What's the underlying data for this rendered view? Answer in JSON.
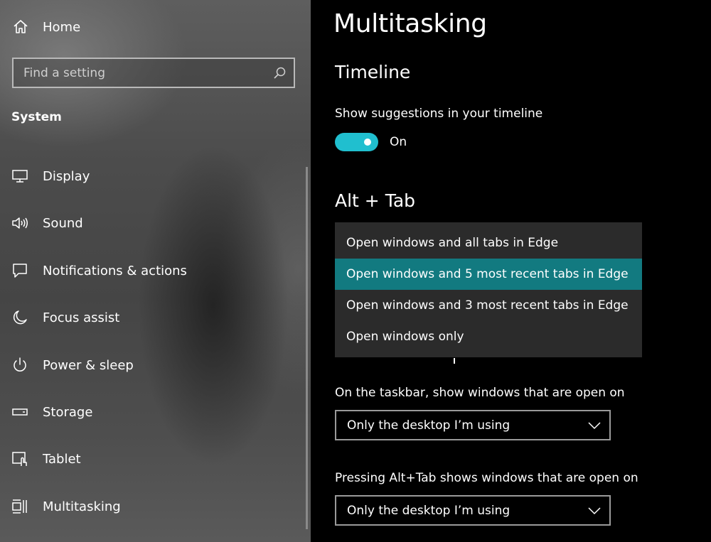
{
  "sidebar": {
    "home_label": "Home",
    "search_placeholder": "Find a setting",
    "section_title": "System",
    "items": [
      {
        "label": "Display",
        "icon": "monitor-icon"
      },
      {
        "label": "Sound",
        "icon": "speaker-icon"
      },
      {
        "label": "Notifications & actions",
        "icon": "notification-icon"
      },
      {
        "label": "Focus assist",
        "icon": "moon-icon"
      },
      {
        "label": "Power & sleep",
        "icon": "power-icon"
      },
      {
        "label": "Storage",
        "icon": "storage-icon"
      },
      {
        "label": "Tablet",
        "icon": "tablet-icon"
      },
      {
        "label": "Multitasking",
        "icon": "multitasking-icon"
      }
    ]
  },
  "main": {
    "title": "Multitasking",
    "timeline": {
      "heading": "Timeline",
      "suggestions_label": "Show suggestions in your timeline",
      "toggle_state": "On",
      "toggle_on": true
    },
    "alt_tab": {
      "heading": "Alt + Tab",
      "options": [
        "Open windows and all tabs in Edge",
        "Open windows and 5 most recent tabs in Edge",
        "Open windows and 3 most recent tabs in Edge",
        "Open windows only"
      ],
      "selected_index": 1
    },
    "taskbar": {
      "label": "On the taskbar, show windows that are open on",
      "value": "Only the desktop I’m using"
    },
    "alttab_desktops": {
      "label": "Pressing Alt+Tab shows windows that are open on",
      "value": "Only the desktop I’m using"
    }
  },
  "colors": {
    "accent": "#20bfcf",
    "selected_option": "#127a80",
    "menu_background": "#2b2b2b",
    "main_background": "#000000"
  }
}
